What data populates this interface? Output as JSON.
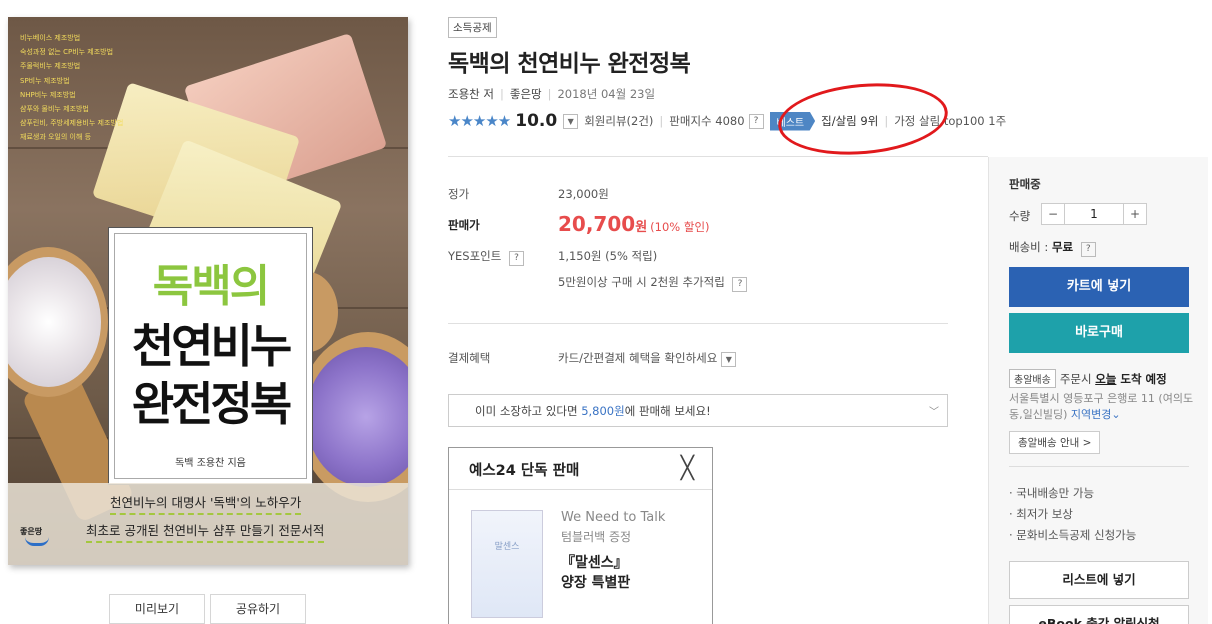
{
  "cover": {
    "bullet_lines": [
      "비누베이스 제조방법",
      "숙성과정 없는 CP비누 제조방법",
      "주물럭비누 제조방법",
      "SP비누 제조방법",
      "NHP비누 제조방법",
      "샴푸와 물비누 제조방법",
      "샴푸린비, 주방세제용비누 제조방법",
      "재료생과 오일의 이해 등"
    ],
    "title_line1": "독백의",
    "title_line2": "천연비누",
    "title_line3": "완전정복",
    "author_line": "독백 조용찬 지음",
    "band_line1": "천연비누의 대명사 '독백'의 노하우가",
    "band_line2": "최초로 공개된 천연비누 샴푸 만들기 전문서적",
    "publisher_logo": "좋은땅",
    "preview_btn": "미리보기",
    "share_btn": "공유하기"
  },
  "product": {
    "category_tag": "소득공제",
    "title": "독백의 천연비누 완전정복",
    "author": "조용찬 저",
    "publisher": "좋은땅",
    "date": "2018년 04월 23일",
    "stars": "★★★★★",
    "score": "10.0",
    "reviews": "회원리뷰(2건)",
    "sales_index": "판매지수 4080",
    "best_badge": "베스트",
    "rank1": "집/살림 9위",
    "rank2": "가정 살림 top100 1주"
  },
  "pricing": {
    "list_label": "정가",
    "list_price": "23,000원",
    "sale_label": "판매가",
    "sale_price": "20,700",
    "sale_unit": "원",
    "discount": "(10% 할인)",
    "points_label": "YES포인트",
    "points": "1,150원 (5% 적립)",
    "bonus": "5만원이상 구매 시 2천원 추가적립",
    "payment_label": "결제혜택",
    "payment_text": "카드/간편결제 혜택을 확인하세요",
    "sell_prefix": "이미 소장하고 있다면 ",
    "sell_amount": "5,800원",
    "sell_suffix": "에 판매해 보세요!"
  },
  "exclusive": {
    "header": "예스24 단독 판매",
    "line1": "We Need to Talk",
    "line2": "텀블러백 증정",
    "line3": "『말센스』",
    "line4": "양장 특별판",
    "thumb_text": "말센스"
  },
  "panel": {
    "status": "판매중",
    "qty_label": "수량",
    "qty_value": "1",
    "shipping_label": "배송비 : ",
    "shipping_value": "무료",
    "cart_btn": "카트에 넣기",
    "buy_btn": "바로구매",
    "delivery_badge": "총알배송",
    "delivery_pre": "주문시 ",
    "delivery_today": "오늘",
    "delivery_eta": " 도착 예정",
    "address": "서울특별시 영등포구 은행로 11 (여의도동,일신빌딩)",
    "address_change": "지역변경",
    "delivery_info_btn": "총알배송 안내 >",
    "bullet1": "· 국내배송만 가능",
    "bullet2": "· 최저가 보상",
    "bullet3": "· 문화비소득공제 신청가능",
    "list_btn": "리스트에 넣기",
    "ebook_btn": "eBook 출간 알림신청"
  },
  "colors": {
    "accent_blue": "#2b62b3",
    "buy_teal": "#1ea1aa",
    "price_red": "#e74c4c",
    "annotation_red": "#e1191c",
    "title_green": "#8cc63f"
  }
}
